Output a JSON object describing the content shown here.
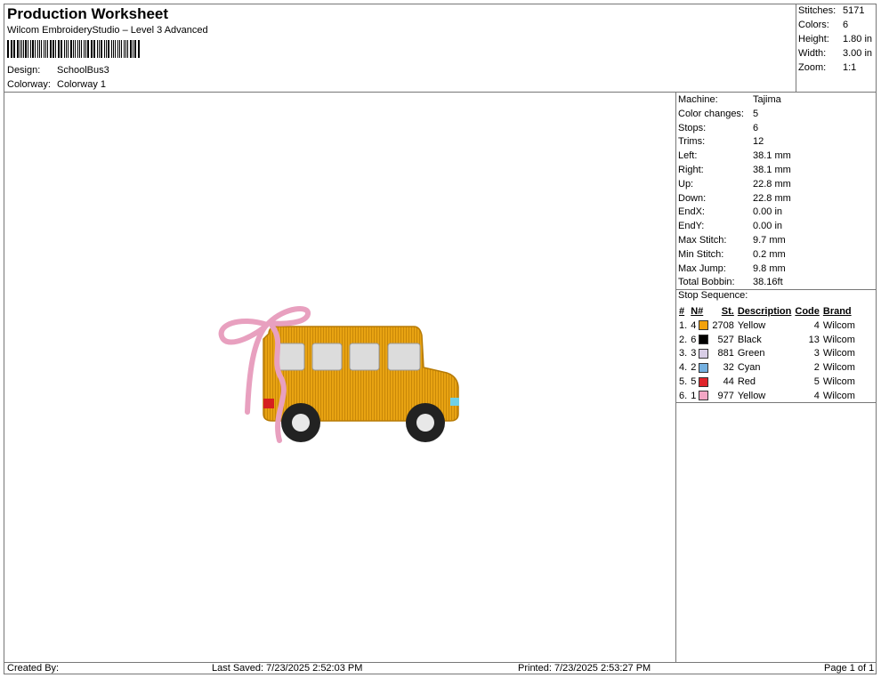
{
  "header": {
    "title": "Production Worksheet",
    "subtitle": "Wilcom EmbroideryStudio – Level 3 Advanced",
    "design_label": "Design:",
    "design_value": "SchoolBus3",
    "colorway_label": "Colorway:",
    "colorway_value": "Colorway 1"
  },
  "stats": [
    {
      "label": "Stitches:",
      "value": "5171"
    },
    {
      "label": "Colors:",
      "value": "6"
    },
    {
      "label": "Height:",
      "value": "1.80 in"
    },
    {
      "label": "Width:",
      "value": "3.00 in"
    },
    {
      "label": "Zoom:",
      "value": "1:1"
    }
  ],
  "specs": [
    {
      "label": "Machine:",
      "value": "Tajima"
    },
    {
      "label": "Color changes:",
      "value": "5"
    },
    {
      "label": "Stops:",
      "value": "6"
    },
    {
      "label": "Trims:",
      "value": "12"
    },
    {
      "label": "Left:",
      "value": "38.1 mm"
    },
    {
      "label": "Right:",
      "value": "38.1 mm"
    },
    {
      "label": "Up:",
      "value": "22.8 mm"
    },
    {
      "label": "Down:",
      "value": "22.8 mm"
    },
    {
      "label": "EndX:",
      "value": "0.00 in"
    },
    {
      "label": "EndY:",
      "value": "0.00 in"
    },
    {
      "label": "Max Stitch:",
      "value": "9.7 mm"
    },
    {
      "label": "Min Stitch:",
      "value": "0.2 mm"
    },
    {
      "label": "Max Jump:",
      "value": "9.8 mm"
    },
    {
      "label": "Total Bobbin:",
      "value": "38.16ft"
    }
  ],
  "sequence": {
    "label": "Stop Sequence:",
    "headers": [
      "#",
      "N#",
      "St.",
      "Description",
      "Code",
      "Brand"
    ],
    "rows": [
      {
        "num": "1.",
        "n": "4",
        "color": "#f2a20c",
        "st": "2708",
        "desc": "Yellow",
        "code": "4",
        "brand": "Wilcom"
      },
      {
        "num": "2.",
        "n": "6",
        "color": "#000000",
        "st": "527",
        "desc": "Black",
        "code": "13",
        "brand": "Wilcom"
      },
      {
        "num": "3.",
        "n": "3",
        "color": "#d8cde6",
        "st": "881",
        "desc": "Green",
        "code": "3",
        "brand": "Wilcom"
      },
      {
        "num": "4.",
        "n": "2",
        "color": "#74b0e0",
        "st": "32",
        "desc": "Cyan",
        "code": "2",
        "brand": "Wilcom"
      },
      {
        "num": "5.",
        "n": "5",
        "color": "#e0242a",
        "st": "44",
        "desc": "Red",
        "code": "5",
        "brand": "Wilcom"
      },
      {
        "num": "6.",
        "n": "1",
        "color": "#f2a6c4",
        "st": "977",
        "desc": "Yellow",
        "code": "4",
        "brand": "Wilcom"
      }
    ]
  },
  "footer": {
    "created": "Created By:",
    "saved": "Last Saved: 7/23/2025 2:52:03 PM",
    "printed": "Printed: 7/23/2025 2:53:27 PM",
    "page": "Page 1 of 1"
  }
}
